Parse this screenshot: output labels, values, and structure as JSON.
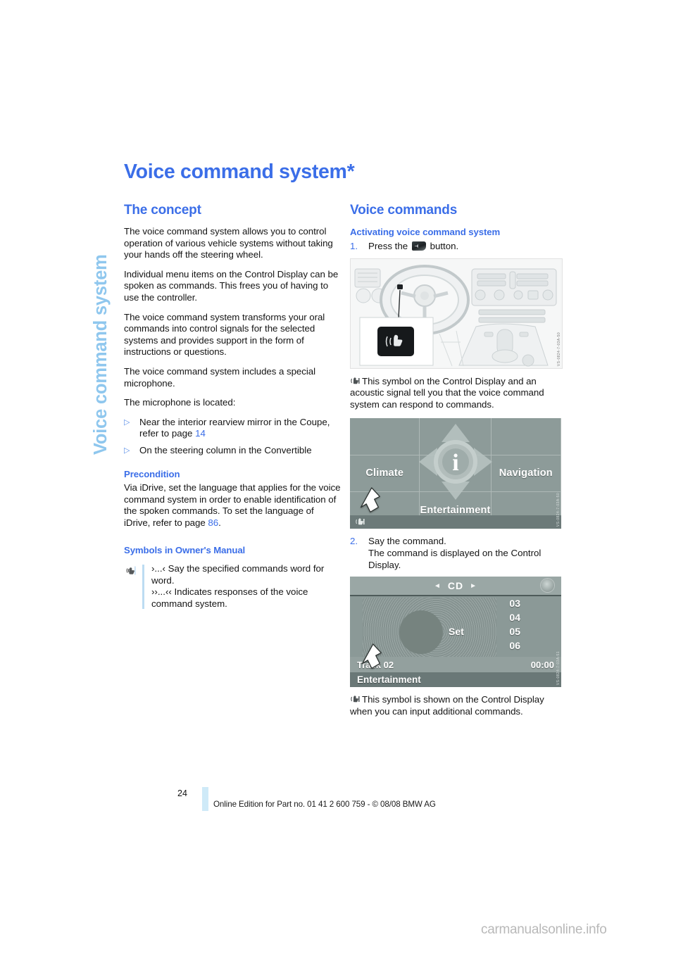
{
  "chapter_tab": "Voice command system",
  "page_title": "Voice command system*",
  "left_column": {
    "section_title": "The concept",
    "paragraphs": [
      "The voice command system allows you to control operation of various vehicle systems without taking your hands off the steering wheel.",
      "Individual menu items on the Control Display can be spoken as commands. This frees you of having to use the controller.",
      "The voice command system transforms your oral commands into control signals for the selected systems and provides support in the form of instructions or questions.",
      "The voice command system includes a special microphone.",
      "The microphone is located:"
    ],
    "bullets": [
      {
        "text": "Near the interior rearview mirror in the Coupe, refer to page ",
        "page_ref": "14"
      },
      {
        "text": "On the steering column in the Convertible",
        "page_ref": ""
      }
    ],
    "precondition": {
      "heading": "Precondition",
      "text_before": "Via iDrive, set the language that applies for the voice command system in order to enable identification of the spoken commands. To set the language of iDrive, refer to page ",
      "page_ref": "86",
      "text_after": "."
    },
    "symbols": {
      "heading": "Symbols in Owner's Manual",
      "icon": "voice-command-hand-icon",
      "line1": "›...‹ Say the specified commands word for word.",
      "line2": "››...‹‹ Indicates responses of the voice command system."
    }
  },
  "right_column": {
    "section_title": "Voice commands",
    "sub_heading": "Activating voice command system",
    "step1": {
      "number": "1.",
      "text_before": "Press the ",
      "button_icon": "voice-button-icon",
      "text_after": " button."
    },
    "figure_cockpit": {
      "name": "cockpit-steering-wheel-photo",
      "code": "VS-0824-7-03A-50"
    },
    "caption1": {
      "icon": "voice-symbol-icon",
      "text": "This symbol on the Control Display and an acoustic signal tell you that the voice command system can respond to commands."
    },
    "figure_idrive": {
      "name": "idrive-main-menu-screenshot",
      "code": "VS-0824-7-03A-50",
      "cells": [
        "",
        "",
        "",
        "Climate",
        "",
        "Navigation",
        "",
        "Entertainment",
        ""
      ],
      "center_icon": "info-i-icon",
      "arrow": "white-pointer-arrow",
      "status_symbol": "voice-symbol-icon"
    },
    "step2": {
      "number": "2.",
      "line1": "Say the command.",
      "line2": "The command is displayed on the Control Display."
    },
    "figure_cd": {
      "name": "cd-player-screenshot",
      "code": "VS-0824-7-03A-51",
      "title": "CD",
      "left_arrow": "◄",
      "right_arrow": "►",
      "home_icon": "home-compass-icon",
      "center_label": "Set",
      "tracks": [
        "03",
        "04",
        "05",
        "06"
      ],
      "track_label": "Track 02",
      "time": "00:00",
      "bottom_label": "Entertainment",
      "arrow": "white-pointer-arrow"
    },
    "caption2": {
      "icon": "voice-symbol-icon",
      "text": "This symbol is shown on the Control Display when you can input additional commands."
    }
  },
  "footer": {
    "page_number": "24",
    "note": "Online Edition for Part no. 01 41 2 600 759 - © 08/08 BMW AG"
  },
  "watermark": "carmanualsonline.info",
  "colors": {
    "heading_blue": "#3b6ee8",
    "tab_blue": "#8fc7ee",
    "rule_blue": "#bcdcf2",
    "body_black": "#141414"
  }
}
